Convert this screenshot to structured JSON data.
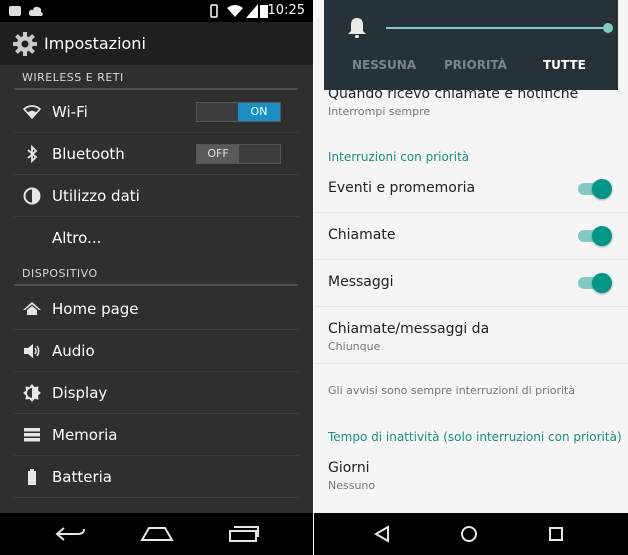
{
  "left_panel": {
    "status_bar": {
      "time": "10:25"
    },
    "action_bar": {
      "title": "Impostazioni"
    },
    "sections": [
      {
        "header": "WIRELESS E RETI",
        "items": [
          {
            "label": "Wi-Fi",
            "icon": "wifi-icon",
            "toggle": "ON"
          },
          {
            "label": "Bluetooth",
            "icon": "bluetooth-icon",
            "toggle": "OFF"
          },
          {
            "label": "Utilizzo dati",
            "icon": "data-usage-icon"
          },
          {
            "label": "Altro..."
          }
        ]
      },
      {
        "header": "DISPOSITIVO",
        "items": [
          {
            "label": "Home page",
            "icon": "home-icon"
          },
          {
            "label": "Audio",
            "icon": "speaker-icon"
          },
          {
            "label": "Display",
            "icon": "display-brightness-icon"
          },
          {
            "label": "Memoria",
            "icon": "storage-icon"
          },
          {
            "label": "Batteria",
            "icon": "battery-icon"
          }
        ]
      }
    ]
  },
  "right_panel": {
    "popup": {
      "icon": "bell-icon",
      "volume_level": 1.0,
      "tabs": [
        "NESSUNA",
        "PRIORITÀ",
        "TUTTE"
      ],
      "active_tab": "TUTTE"
    },
    "top_item": {
      "title": "Quando ricevo chiamate e notifiche",
      "subtitle": "Interrompi sempre"
    },
    "priority_header": "Interruzioni con priorità",
    "toggles": [
      {
        "label": "Eventi e promemoria",
        "checked": true
      },
      {
        "label": "Chiamate",
        "checked": true
      },
      {
        "label": "Messaggi",
        "checked": true
      }
    ],
    "from_item": {
      "title": "Chiamate/messaggi da",
      "subtitle": "Chiunque"
    },
    "note": "Gli avvisi sono sempre interruzioni di priorità",
    "downtime_header": "Tempo di inattività (solo interruzioni con priorità)",
    "days_item": {
      "title": "Giorni",
      "subtitle": "Nessuno"
    }
  },
  "colors": {
    "kitkat_accent": "#1a8fc4",
    "lollipop_teal": "#009688",
    "lollipop_teal_light": "#80cbc4"
  }
}
